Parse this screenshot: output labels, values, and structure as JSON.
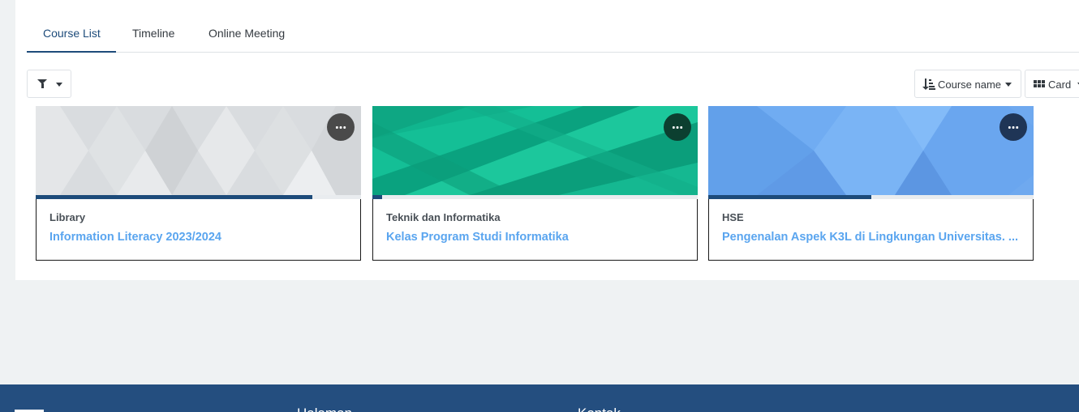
{
  "tabs": [
    {
      "label": "Course List",
      "active": true
    },
    {
      "label": "Timeline",
      "active": false
    },
    {
      "label": "Online Meeting",
      "active": false
    }
  ],
  "toolbar": {
    "filter_icon": "filter-icon",
    "sort_icon": "sort-amount-down-icon",
    "sort_label": "Course name",
    "view_icon": "grid-icon",
    "view_label": "Card"
  },
  "courses": [
    {
      "category": "Library",
      "name": "Information Literacy 2023/2024",
      "progress": 0.85,
      "theme": "gray",
      "menu_color": "#4a4a4a"
    },
    {
      "category": "Teknik dan Informatika",
      "name": "Kelas Program Studi Informatika",
      "progress": 0.03,
      "theme": "green",
      "menu_color": "#0c3f30"
    },
    {
      "category": "HSE",
      "name": "Pengenalan Aspek K3L di Lingkungan Universitas. ...",
      "progress": 0.5,
      "theme": "blue",
      "menu_color": "#1f3556"
    }
  ],
  "footer": {
    "headings": [
      "Halaman",
      "Kontak"
    ]
  },
  "colors": {
    "accent": "#1d4b7a",
    "link": "#5aa5ef",
    "footer_bg": "#244e7f",
    "page_bg": "#eff2f3"
  }
}
